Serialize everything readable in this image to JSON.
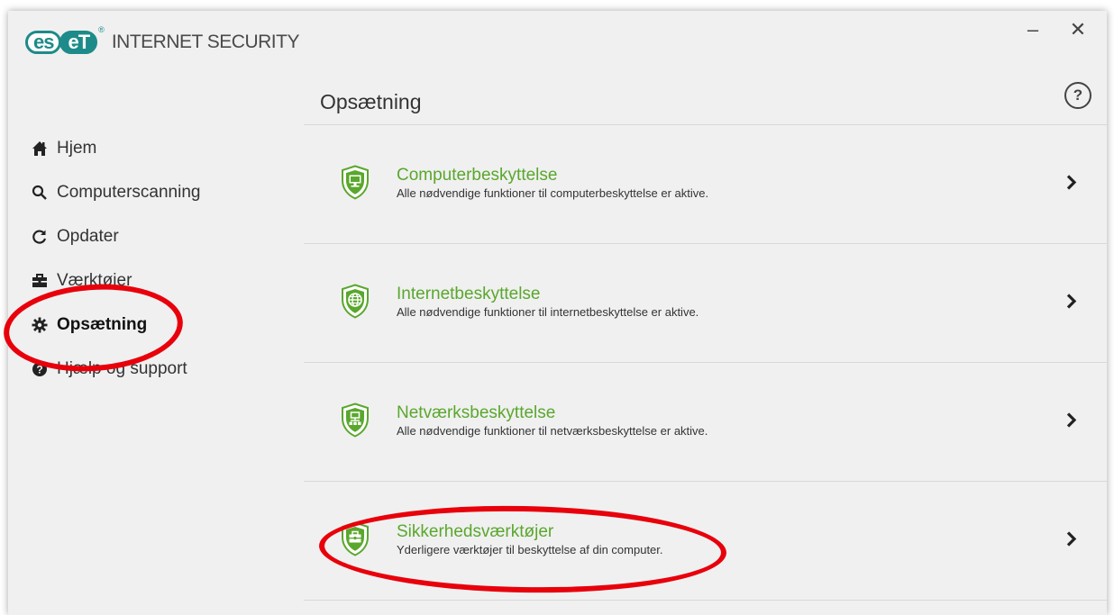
{
  "app": {
    "logo_left": "es",
    "logo_right": "eT",
    "logo_reg": "®",
    "product_name": "INTERNET SECURITY"
  },
  "window_controls": {
    "minimize": "–",
    "close": "✕"
  },
  "sidebar": {
    "items": [
      {
        "label": "Hjem",
        "icon": "home-icon"
      },
      {
        "label": "Computerscanning",
        "icon": "search-icon"
      },
      {
        "label": "Opdater",
        "icon": "refresh-icon"
      },
      {
        "label": "Værktøjer",
        "icon": "toolbox-icon"
      },
      {
        "label": "Opsætning",
        "icon": "gear-icon",
        "active": true
      },
      {
        "label": "Hjælp og support",
        "icon": "help-icon"
      }
    ]
  },
  "main": {
    "title": "Opsætning",
    "help_label": "?",
    "sections": [
      {
        "title": "Computerbeskyttelse",
        "description": "Alle nødvendige funktioner til computerbeskyttelse er aktive.",
        "icon": "computer-shield-icon"
      },
      {
        "title": "Internetbeskyttelse",
        "description": "Alle nødvendige funktioner til internetbeskyttelse er aktive.",
        "icon": "globe-shield-icon"
      },
      {
        "title": "Netværksbeskyttelse",
        "description": "Alle nødvendige funktioner til netværksbeskyttelse er aktive.",
        "icon": "network-shield-icon"
      },
      {
        "title": "Sikkerhedsværktøjer",
        "description": "Yderligere værktøjer til beskyttelse af din computer.",
        "icon": "toolbox-shield-icon"
      }
    ]
  },
  "colors": {
    "brand": "#1d8b89",
    "accent_green": "#5aa72d",
    "annotation_red": "#e8000b",
    "background": "#f0f0f0"
  }
}
